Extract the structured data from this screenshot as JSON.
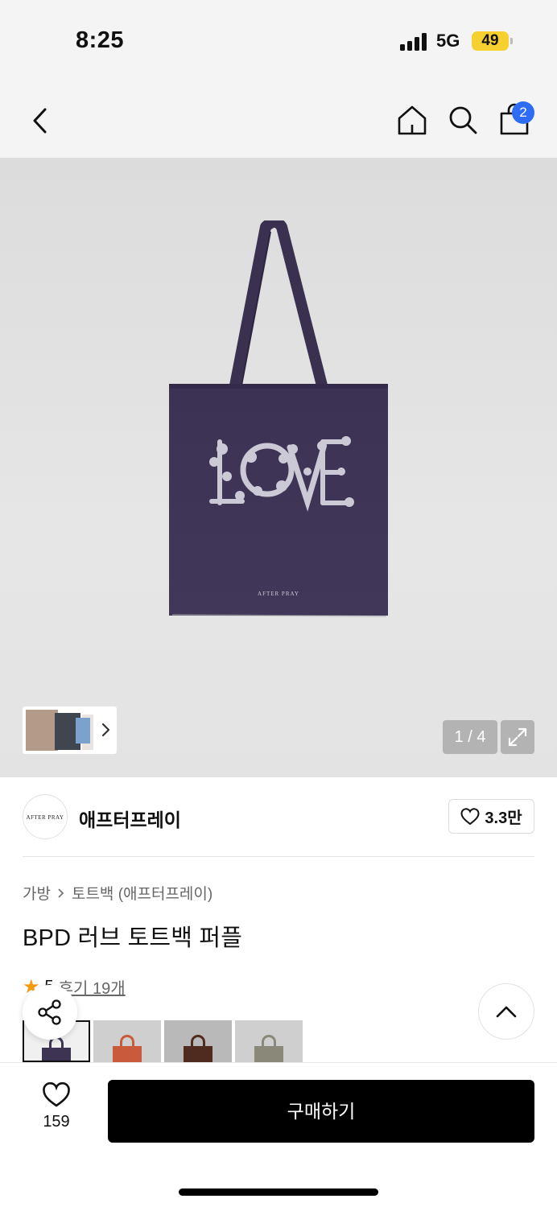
{
  "status_bar": {
    "time": "8:25",
    "network": "5G",
    "battery": "49"
  },
  "nav": {
    "cart_count": "2"
  },
  "icons": {
    "back": "chevron-left-icon",
    "home": "home-icon",
    "search": "search-icon",
    "cart": "shopping-bag-icon",
    "expand": "expand-icon",
    "heart": "heart-icon",
    "share": "share-icon",
    "up": "chevron-up-icon",
    "star": "star-icon"
  },
  "gallery": {
    "counter": "1 / 4",
    "product_print_text": "LOVE",
    "bag_label": "AFTER PRAY"
  },
  "brand": {
    "logo_text": "AFTER PRAY",
    "name": "애프터프레이",
    "likes": "3.3만"
  },
  "product": {
    "breadcrumb": [
      "가방",
      "토트백 (애프터프레이)"
    ],
    "title": "BPD 러브 토트백 퍼플",
    "rating": "5",
    "reviews": "후기 19개"
  },
  "swatches": [
    {
      "name": "purple",
      "color": "#3d3454",
      "selected": true
    },
    {
      "name": "orange",
      "color": "#c95a3c",
      "selected": false
    },
    {
      "name": "brown",
      "color": "#4e2a1f",
      "selected": false
    },
    {
      "name": "khaki",
      "color": "#8a8878",
      "selected": false
    }
  ],
  "bottom": {
    "wish_count": "159",
    "buy_label": "구매하기"
  },
  "colors": {
    "bag": "#3f3556",
    "badge": "#2f6cf5",
    "star": "#f59b12",
    "battery": "#f6d02f"
  }
}
